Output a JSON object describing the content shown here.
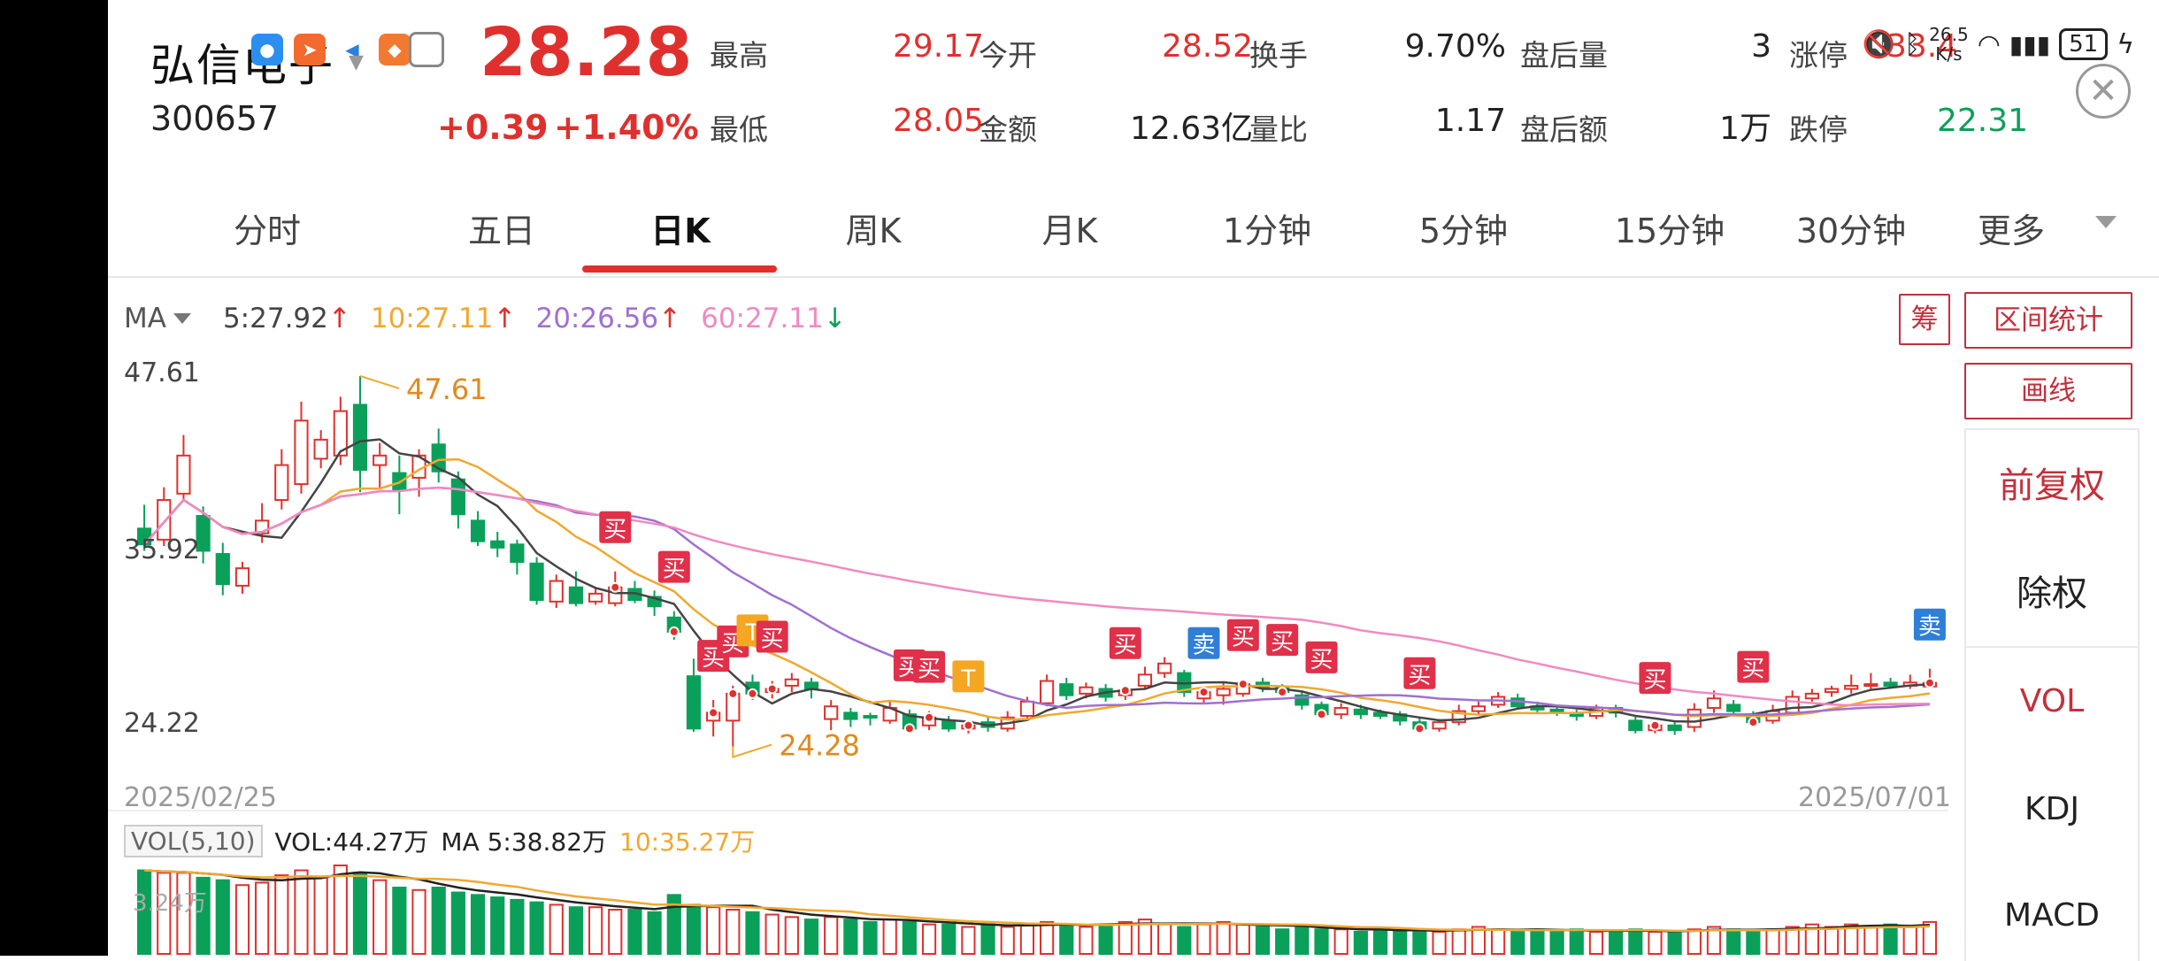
{
  "stock": {
    "name": "弘信电子",
    "code": "300657",
    "price": "28.28",
    "change": "+0.39",
    "change_pct": "+1.40%"
  },
  "quote": [
    {
      "label": "最高",
      "value": "29.17",
      "color": "red"
    },
    {
      "label": "今开",
      "value": "28.52",
      "color": "red"
    },
    {
      "label": "换手",
      "value": "9.70%",
      "color": "dark"
    },
    {
      "label": "盘后量",
      "value": "3",
      "color": "dark"
    },
    {
      "label": "涨停",
      "value": "33.47",
      "color": "red"
    },
    {
      "label": "最低",
      "value": "28.05",
      "color": "red"
    },
    {
      "label": "金额",
      "value": "12.63亿",
      "color": "dark"
    },
    {
      "label": "量比",
      "value": "1.17",
      "color": "dark"
    },
    {
      "label": "盘后额",
      "value": "1万",
      "color": "dark"
    },
    {
      "label": "跌停",
      "value": "22.31",
      "color": "green"
    }
  ],
  "status_bar": {
    "net_speed": "26.5",
    "net_unit": "K/s",
    "battery": "51"
  },
  "tabs": [
    {
      "label": "分时",
      "active": false
    },
    {
      "label": "五日",
      "active": false
    },
    {
      "label": "日K",
      "active": true
    },
    {
      "label": "周K",
      "active": false
    },
    {
      "label": "月K",
      "active": false
    },
    {
      "label": "1分钟",
      "active": false
    },
    {
      "label": "5分钟",
      "active": false
    },
    {
      "label": "15分钟",
      "active": false
    },
    {
      "label": "30分钟",
      "active": false
    },
    {
      "label": "更多",
      "active": false
    }
  ],
  "ma_legend": {
    "label": "MA",
    "items": [
      {
        "text": "5:27.92",
        "arrow": "↑",
        "color": "#444444"
      },
      {
        "text": "10:27.11",
        "arrow": "↑",
        "color": "#f0a830"
      },
      {
        "text": "20:26.56",
        "arrow": "↑",
        "color": "#a070d0"
      },
      {
        "text": "60:27.11",
        "arrow": "↓",
        "color": "#f08ac0"
      }
    ]
  },
  "right_buttons": {
    "chips": "筹",
    "range_stats": "区间统计",
    "draw": "画线"
  },
  "panel_items": [
    {
      "label": "前复权",
      "color": "#c2303c"
    },
    {
      "label": "除权",
      "color": "#222222"
    },
    {
      "label": "VOL",
      "color": "#c2303c"
    },
    {
      "label": "KDJ",
      "color": "#222222"
    },
    {
      "label": "MACD",
      "color": "#222222"
    }
  ],
  "vol_legend": {
    "box": "VOL(5,10)",
    "vol": "VOL:44.27万",
    "ma5": "MA 5:38.82万",
    "ma10": "10:35.27万",
    "scale": "3.24万"
  },
  "colors": {
    "up": "#e0302d",
    "down": "#0aa05a",
    "ma5": "#444444",
    "ma10": "#f0a830",
    "ma20": "#a070d0",
    "ma60": "#f08ac0",
    "buy_tag": "#e0304a",
    "sell_tag": "#2f7fd6",
    "t_tag": "#f5a623"
  },
  "chart_data": {
    "type": "candlestick",
    "ylim": [
      22.8,
      49.0
    ],
    "y_ticks": [
      "47.61",
      "35.92",
      "24.22"
    ],
    "y_tick_values": [
      47.61,
      35.92,
      24.22
    ],
    "x_start": "2025/02/25",
    "x_end": "2025/07/01",
    "high_mark": "47.61",
    "low_mark": "24.28",
    "high_value": 47.61,
    "low_value": 24.28,
    "high_index": 11,
    "low_index": 30,
    "candles": [
      [
        38.0,
        37.0,
        39.5,
        36.6
      ],
      [
        37.3,
        39.8,
        40.6,
        36.9
      ],
      [
        40.2,
        42.6,
        43.9,
        39.7
      ],
      [
        38.8,
        36.6,
        39.4,
        35.8
      ],
      [
        36.4,
        34.5,
        37.1,
        33.8
      ],
      [
        34.4,
        35.5,
        35.9,
        33.9
      ],
      [
        37.7,
        38.5,
        39.6,
        37.1
      ],
      [
        39.8,
        42.0,
        43.0,
        39.2
      ],
      [
        40.8,
        44.8,
        46.0,
        40.2
      ],
      [
        42.4,
        43.6,
        44.2,
        41.8
      ],
      [
        42.6,
        45.4,
        46.3,
        42.0
      ],
      [
        45.8,
        41.7,
        47.61,
        40.3
      ],
      [
        42.0,
        42.6,
        43.4,
        40.5
      ],
      [
        41.5,
        40.4,
        42.6,
        38.9
      ],
      [
        41.2,
        42.6,
        43.0,
        40.0
      ],
      [
        43.3,
        41.6,
        44.3,
        40.9
      ],
      [
        41.1,
        38.9,
        41.6,
        38.0
      ],
      [
        38.5,
        37.2,
        39.1,
        36.9
      ],
      [
        37.2,
        36.8,
        37.8,
        36.2
      ],
      [
        37.0,
        35.9,
        37.3,
        35.1
      ],
      [
        35.8,
        33.5,
        36.2,
        33.2
      ],
      [
        33.4,
        34.7,
        35.1,
        33.0
      ],
      [
        34.3,
        33.3,
        35.3,
        33.1
      ],
      [
        33.4,
        33.9,
        34.3,
        33.2
      ],
      [
        33.3,
        34.3,
        35.3,
        33.1
      ],
      [
        34.2,
        33.5,
        34.7,
        33.3
      ],
      [
        33.7,
        33.1,
        34.1,
        32.5
      ],
      [
        32.4,
        31.5,
        32.8,
        31.0
      ],
      [
        28.7,
        25.4,
        29.8,
        25.2
      ],
      [
        25.9,
        26.4,
        27.2,
        24.9
      ],
      [
        25.9,
        27.6,
        28.1,
        24.28
      ],
      [
        28.3,
        27.6,
        28.8,
        27.2
      ],
      [
        27.7,
        27.9,
        28.4,
        27.3
      ],
      [
        28.1,
        28.5,
        28.9,
        27.7
      ],
      [
        28.3,
        27.9,
        28.6,
        27.3
      ],
      [
        26.0,
        26.8,
        27.2,
        25.3
      ],
      [
        26.4,
        26.0,
        26.7,
        25.5
      ],
      [
        26.2,
        26.1,
        26.4,
        25.6
      ],
      [
        25.9,
        26.7,
        27.1,
        25.7
      ],
      [
        26.3,
        25.4,
        26.6,
        25.1
      ],
      [
        25.6,
        26.1,
        26.5,
        25.3
      ],
      [
        25.9,
        25.4,
        26.2,
        25.2
      ],
      [
        25.4,
        25.6,
        25.9,
        25.1
      ],
      [
        25.8,
        25.5,
        26.1,
        25.2
      ],
      [
        25.4,
        26.1,
        26.5,
        25.2
      ],
      [
        26.2,
        27.1,
        27.4,
        26.0
      ],
      [
        27.0,
        28.4,
        28.8,
        26.8
      ],
      [
        28.2,
        27.5,
        28.6,
        27.2
      ],
      [
        27.6,
        28.0,
        28.3,
        27.3
      ],
      [
        27.9,
        27.4,
        28.2,
        27.1
      ],
      [
        27.5,
        27.8,
        28.0,
        27.2
      ],
      [
        28.1,
        28.8,
        29.3,
        27.9
      ],
      [
        28.9,
        29.5,
        29.9,
        28.6
      ],
      [
        28.9,
        27.7,
        29.1,
        27.4
      ],
      [
        27.3,
        27.7,
        28.0,
        27.0
      ],
      [
        27.5,
        27.9,
        28.3,
        26.9
      ],
      [
        27.6,
        28.2,
        28.5,
        27.4
      ],
      [
        28.3,
        28.0,
        28.6,
        27.7
      ],
      [
        28.0,
        27.7,
        28.2,
        27.4
      ],
      [
        27.5,
        26.9,
        27.8,
        26.6
      ],
      [
        26.9,
        26.3,
        27.1,
        26.0
      ],
      [
        26.3,
        26.7,
        27.0,
        26.0
      ],
      [
        26.6,
        26.3,
        26.9,
        26.0
      ],
      [
        26.4,
        26.2,
        26.6,
        26.0
      ],
      [
        26.3,
        25.9,
        26.5,
        25.6
      ],
      [
        25.8,
        25.4,
        26.1,
        25.2
      ],
      [
        25.4,
        25.8,
        26.0,
        25.2
      ],
      [
        25.8,
        26.5,
        26.9,
        25.6
      ],
      [
        26.5,
        26.8,
        27.1,
        26.3
      ],
      [
        26.9,
        27.4,
        27.7,
        26.7
      ],
      [
        27.3,
        26.8,
        27.6,
        26.6
      ],
      [
        26.8,
        26.6,
        27.1,
        26.4
      ],
      [
        26.6,
        26.4,
        26.9,
        26.2
      ],
      [
        26.4,
        26.2,
        26.6,
        25.9
      ],
      [
        26.2,
        26.7,
        26.9,
        26.0
      ],
      [
        26.7,
        26.4,
        26.9,
        26.1
      ],
      [
        25.9,
        25.3,
        26.2,
        25.1
      ],
      [
        25.3,
        25.6,
        25.8,
        25.1
      ],
      [
        25.6,
        25.3,
        25.9,
        25.0
      ],
      [
        25.5,
        26.6,
        27.0,
        25.2
      ],
      [
        26.7,
        27.3,
        27.8,
        26.4
      ],
      [
        26.9,
        26.5,
        27.2,
        26.3
      ],
      [
        26.2,
        25.8,
        26.5,
        25.5
      ],
      [
        25.9,
        26.5,
        26.9,
        25.7
      ],
      [
        26.4,
        27.4,
        27.8,
        26.2
      ],
      [
        27.3,
        27.6,
        27.9,
        27.1
      ],
      [
        27.7,
        27.9,
        28.1,
        27.4
      ],
      [
        27.9,
        28.1,
        28.8,
        27.6
      ],
      [
        28.1,
        28.2,
        28.9,
        27.8
      ],
      [
        28.3,
        28.1,
        28.6,
        27.9
      ],
      [
        28.1,
        28.3,
        28.8,
        27.9
      ],
      [
        28.05,
        28.28,
        29.17,
        28.05
      ]
    ],
    "signals": [
      {
        "i": 24,
        "type": "buy",
        "label": "买"
      },
      {
        "i": 27,
        "type": "buy",
        "label": "买"
      },
      {
        "i": 29,
        "type": "buy",
        "label": "买"
      },
      {
        "i": 30,
        "type": "buy",
        "label": "买"
      },
      {
        "i": 31,
        "type": "T",
        "label": "T"
      },
      {
        "i": 32,
        "type": "buy",
        "label": "买"
      },
      {
        "i": 39,
        "type": "buy",
        "label": "买"
      },
      {
        "i": 40,
        "type": "buy",
        "label": "买"
      },
      {
        "i": 42,
        "type": "T",
        "label": "T"
      },
      {
        "i": 50,
        "type": "buy",
        "label": "买"
      },
      {
        "i": 54,
        "type": "sell",
        "label": "卖"
      },
      {
        "i": 56,
        "type": "buy",
        "label": "买"
      },
      {
        "i": 58,
        "type": "buy",
        "label": "买"
      },
      {
        "i": 60,
        "type": "buy",
        "label": "买"
      },
      {
        "i": 65,
        "type": "buy",
        "label": "买"
      },
      {
        "i": 77,
        "type": "buy",
        "label": "买"
      },
      {
        "i": 82,
        "type": "buy",
        "label": "买"
      },
      {
        "i": 91,
        "type": "sell",
        "label": "卖"
      }
    ],
    "volume": [
      3.4,
      3.3,
      3.3,
      3.1,
      3.0,
      2.8,
      2.9,
      3.2,
      3.4,
      3.1,
      3.6,
      3.3,
      3.0,
      2.7,
      2.6,
      2.7,
      2.5,
      2.4,
      2.3,
      2.2,
      2.1,
      2.0,
      1.9,
      1.9,
      1.8,
      1.8,
      1.7,
      2.4,
      2.0,
      1.9,
      1.8,
      1.7,
      1.6,
      1.5,
      1.4,
      1.5,
      1.4,
      1.3,
      1.4,
      1.3,
      1.2,
      1.2,
      1.1,
      1.2,
      1.1,
      1.2,
      1.3,
      1.2,
      1.1,
      1.2,
      1.3,
      1.4,
      1.2,
      1.1,
      1.2,
      1.3,
      1.2,
      1.1,
      1.0,
      1.1,
      1.0,
      1.0,
      0.9,
      1.0,
      0.9,
      1.0,
      0.9,
      1.0,
      1.1,
      1.0,
      0.9,
      1.0,
      0.9,
      1.0,
      0.9,
      0.9,
      1.0,
      0.9,
      0.9,
      1.0,
      1.1,
      1.0,
      0.9,
      1.0,
      1.1,
      1.2,
      1.1,
      1.2,
      1.1,
      1.2,
      1.1,
      1.3
    ]
  }
}
